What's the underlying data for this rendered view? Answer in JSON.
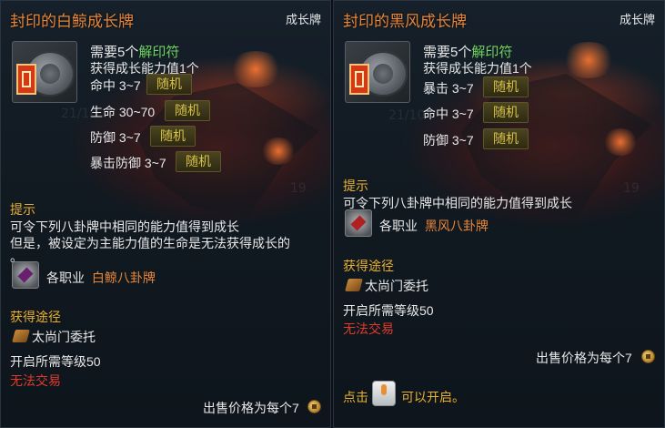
{
  "left": {
    "title": "封印的白鲸成长牌",
    "tag": "成长牌",
    "req_prefix": "需要5个",
    "req_item": "解印符",
    "gain": "获得成长能力值1个",
    "stats": [
      {
        "name": "命中 3~7",
        "rand": "随机"
      },
      {
        "name": "生命 30~70",
        "rand": "随机"
      },
      {
        "name": "防御 3~7",
        "rand": "随机"
      },
      {
        "name": "暴击防御 3~7",
        "rand": "随机"
      }
    ],
    "hint_title": "提示",
    "hint_line1": "可令下列八卦牌中相同的能力值得到成长",
    "hint_line2": "但是，被设定为主能力值的生命是无法获得成长的",
    "hint_line3": "。",
    "class_prefix": "各职业",
    "class_item": "白鲸八卦牌",
    "route_title": "获得途径",
    "route_item": "太尚门委托",
    "level_req": "开启所需等级50",
    "trade": "无法交易",
    "price": "出售价格为每个7"
  },
  "right": {
    "title": "封印的黑风成长牌",
    "tag": "成长牌",
    "req_prefix": "需要5个",
    "req_item": "解印符",
    "gain": "获得成长能力值1个",
    "stats": [
      {
        "name": "暴击 3~7",
        "rand": "随机"
      },
      {
        "name": "命中 3~7",
        "rand": "随机"
      },
      {
        "name": "防御 3~7",
        "rand": "随机"
      }
    ],
    "hint_title": "提示",
    "hint_line1": "可令下列八卦牌中相同的能力值得到成长",
    "class_prefix": "各职业",
    "class_item": "黑风八卦牌",
    "route_title": "获得途径",
    "route_item": "太尚门委托",
    "level_req": "开启所需等级50",
    "trade": "无法交易",
    "price": "出售价格为每个7",
    "click_prefix": "点击",
    "click_suffix": "可以开启。"
  },
  "background_marks": [
    "21/10",
    "19",
    "19"
  ],
  "colors": {
    "title": "#e8873a",
    "green": "#6fd25f",
    "gold": "#e8b030",
    "red": "#e03b2a",
    "random_badge": "#d6c045"
  },
  "icons": [
    "growth-card-icon",
    "class-badge-icon",
    "scroll-icon",
    "coin-icon",
    "click-item-icon"
  ]
}
